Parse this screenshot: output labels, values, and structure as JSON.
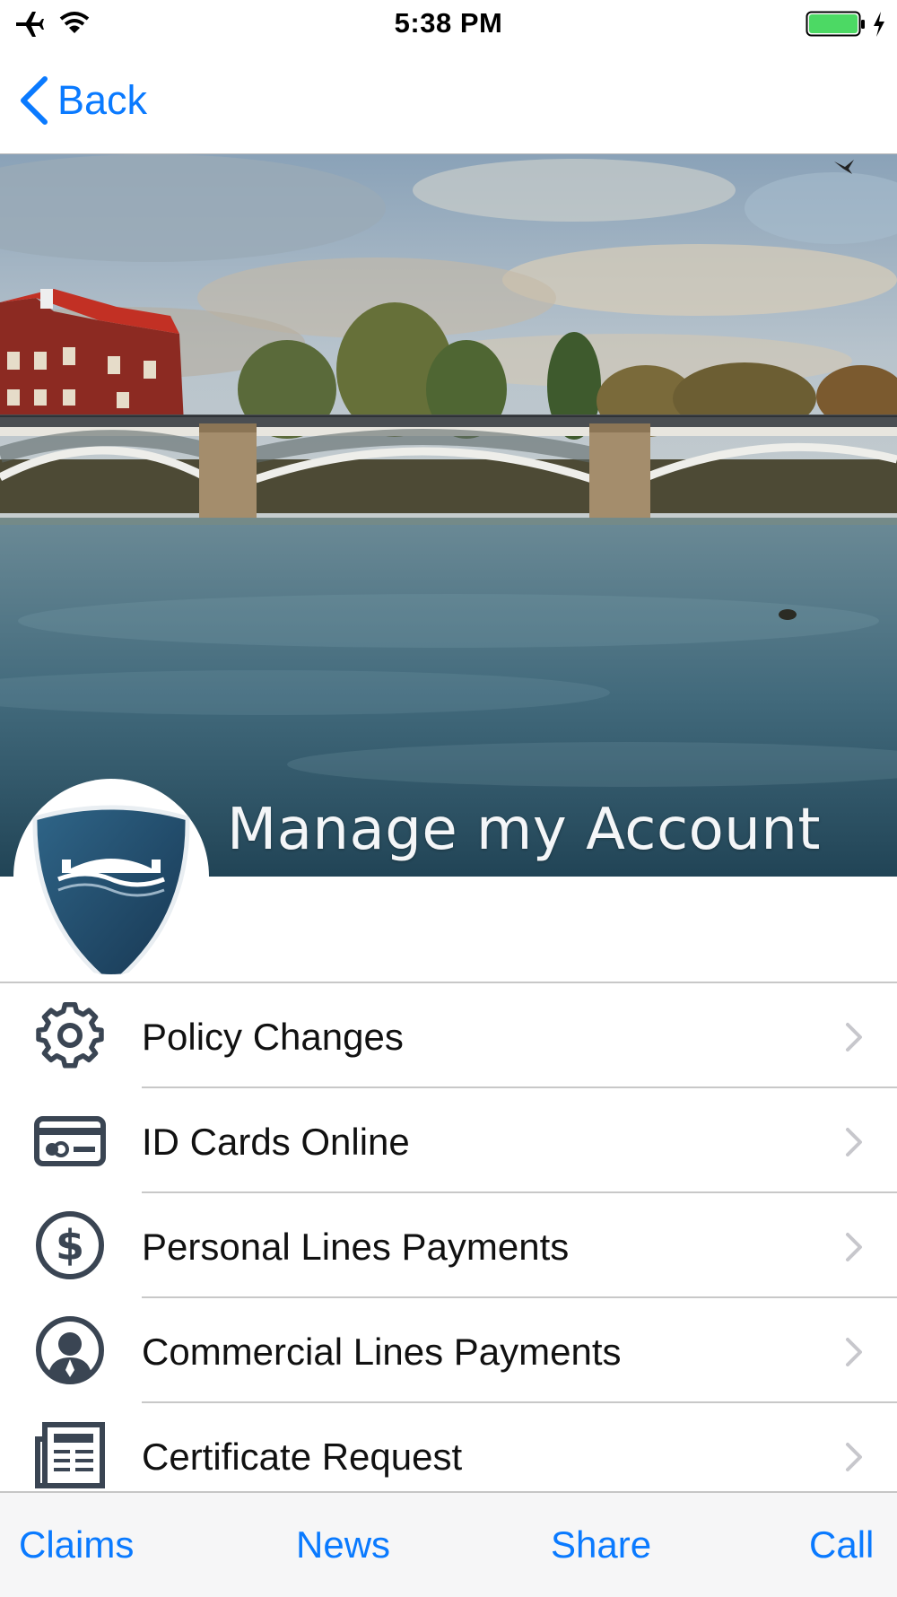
{
  "status_bar": {
    "time": "5:38 PM",
    "icons": [
      "airplane-icon",
      "wifi-icon",
      "battery-icon",
      "charging-bolt-icon"
    ],
    "battery_color": "#4cd964"
  },
  "nav": {
    "back_label": "Back",
    "back_icon": "chevron-left-icon",
    "accent": "#0a7aff"
  },
  "hero": {
    "title": "Manage my Account",
    "logo": "bridge-shield-logo"
  },
  "menu": {
    "items": [
      {
        "label": "Policy Changes",
        "icon": "gear-icon"
      },
      {
        "label": "ID Cards Online",
        "icon": "id-card-icon"
      },
      {
        "label": "Personal Lines Payments",
        "icon": "dollar-circle-icon"
      },
      {
        "label": "Commercial Lines Payments",
        "icon": "person-circle-icon"
      },
      {
        "label": "Certificate Request",
        "icon": "document-icon"
      }
    ],
    "chevron_icon": "chevron-right-icon",
    "icon_color": "#3a4553"
  },
  "tab_bar": {
    "tabs": [
      "Claims",
      "News",
      "Share",
      "Call"
    ]
  }
}
